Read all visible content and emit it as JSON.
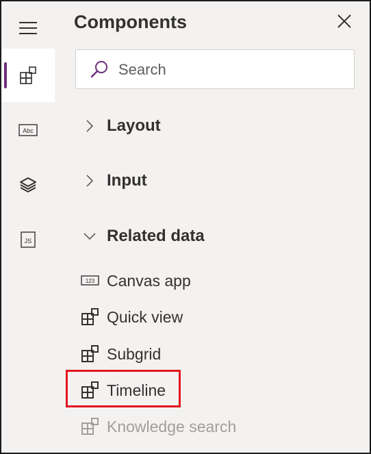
{
  "panel": {
    "title": "Components",
    "search_placeholder": "Search"
  },
  "sections": [
    {
      "label": "Layout",
      "expanded": false
    },
    {
      "label": "Input",
      "expanded": false
    },
    {
      "label": "Related data",
      "expanded": true
    }
  ],
  "related_items": [
    {
      "label": "Canvas app",
      "icon": "numeric-input-icon",
      "enabled": true
    },
    {
      "label": "Quick view",
      "icon": "grid-add-icon",
      "enabled": true
    },
    {
      "label": "Subgrid",
      "icon": "grid-add-icon",
      "enabled": true
    },
    {
      "label": "Timeline",
      "icon": "grid-add-icon",
      "enabled": true,
      "highlighted": true
    },
    {
      "label": "Knowledge search",
      "icon": "grid-add-icon",
      "enabled": false
    }
  ],
  "rail": [
    {
      "icon": "components-icon",
      "active": true
    },
    {
      "icon": "text-field-icon",
      "active": false
    },
    {
      "icon": "layers-icon",
      "active": false
    },
    {
      "icon": "javascript-file-icon",
      "active": false
    }
  ],
  "colors": {
    "accent": "#6b2d7b",
    "highlight_border": "#e3141c",
    "panel_bg": "#f3f2f1"
  }
}
